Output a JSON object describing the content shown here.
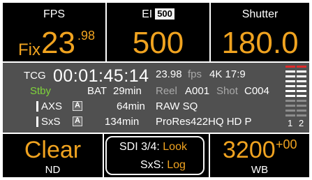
{
  "fps": {
    "label": "FPS",
    "mode": "Fix",
    "value_int": "23",
    "value_dec": ".98"
  },
  "ei": {
    "label": "EI",
    "badge": "500",
    "value": "500"
  },
  "shutter": {
    "label": "Shutter",
    "value": "180.0"
  },
  "status": {
    "tcg_label": "TCG",
    "timecode": "00:01:45:14",
    "framerate": "23.98",
    "fps_unit": "fps",
    "resolution": "4K 17:9",
    "record_state": "Stby",
    "battery_label": "BAT",
    "battery_value": "29min",
    "reel_label": "Reel",
    "reel_value": "A001",
    "shot_label": "Shot",
    "shot_value": "C004",
    "media_1_name": "AXS",
    "media_1_slot": "A",
    "media_1_time": "64min",
    "media_1_format": "RAW SQ",
    "media_2_name": "SxS",
    "media_2_slot": "A",
    "media_2_time": "134min",
    "media_2_format": "ProRes422HQ HD P",
    "audio_ch1": "1",
    "audio_ch2": "2"
  },
  "nd": {
    "value": "Clear",
    "label": "ND"
  },
  "sdi": {
    "line1_label": "SDI 3/4:",
    "line1_value": "Look",
    "line2_label": "SxS:",
    "line2_value": "Log"
  },
  "wb": {
    "value": "3200",
    "offset": "+00",
    "label": "WB"
  },
  "colors": {
    "accent": "#f0a320",
    "standby": "#7fd43a",
    "meter_peak": "#e02b2b",
    "panel": "#505050"
  }
}
